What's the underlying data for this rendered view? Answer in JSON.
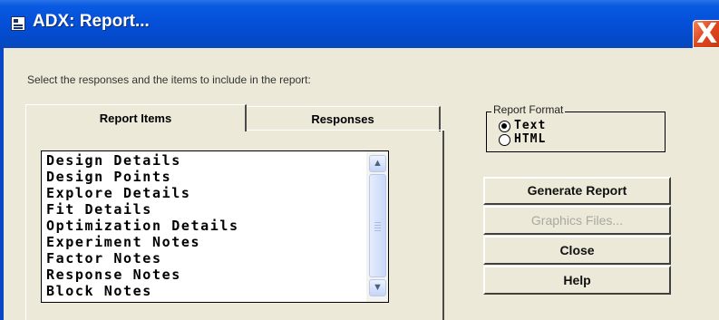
{
  "window": {
    "title": "ADX: Report...",
    "app_icon": "report-window-icon",
    "close_symbol": "X"
  },
  "instruction": "Select the responses and the items to include in the report:",
  "tabs": [
    {
      "label": "Report Items",
      "active": true
    },
    {
      "label": "Responses",
      "active": false
    }
  ],
  "report_items": [
    "Design Details",
    "Design Points",
    "Explore Details",
    "Fit Details",
    "Optimization Details",
    "Experiment Notes",
    "Factor Notes",
    "Response Notes",
    "Block Notes"
  ],
  "report_format": {
    "legend": "Report Format",
    "options": [
      {
        "label": "Text",
        "selected": true
      },
      {
        "label": "HTML",
        "selected": false
      }
    ]
  },
  "buttons": {
    "generate": "Generate Report",
    "graphics": "Graphics Files...",
    "close": "Close",
    "help": "Help"
  },
  "colors": {
    "titlebar": "#0550d8",
    "client_bg": "#ece9d8",
    "close_button": "#e0461f"
  }
}
